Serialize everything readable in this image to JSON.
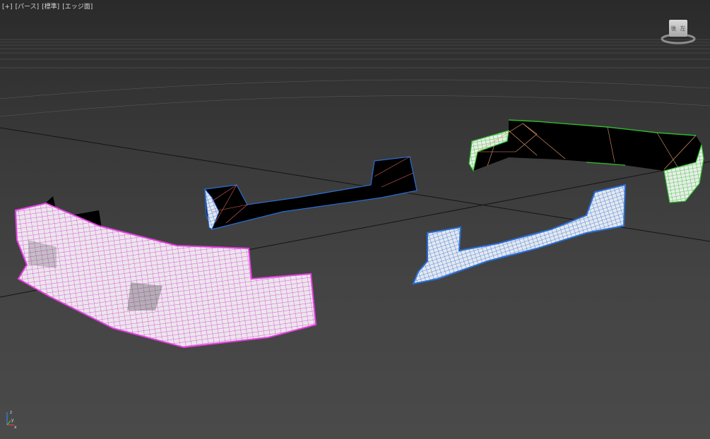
{
  "viewport": {
    "labels": [
      "[+]",
      "[パース]",
      "[標準]",
      "[エッジ面]"
    ]
  },
  "viewcube": {
    "face_left": "後",
    "face_right": "左"
  },
  "axes": {
    "z": "z",
    "y": "y",
    "x": "x"
  },
  "colors": {
    "front_bumper": "#e23fe0",
    "side_skirt": "#2a6ed6",
    "rear_bumper": "#2fb82f",
    "inner_edges": "#e8a070",
    "grid_major": "#1a1a1a",
    "grid_minor": "#5a5a5a"
  }
}
